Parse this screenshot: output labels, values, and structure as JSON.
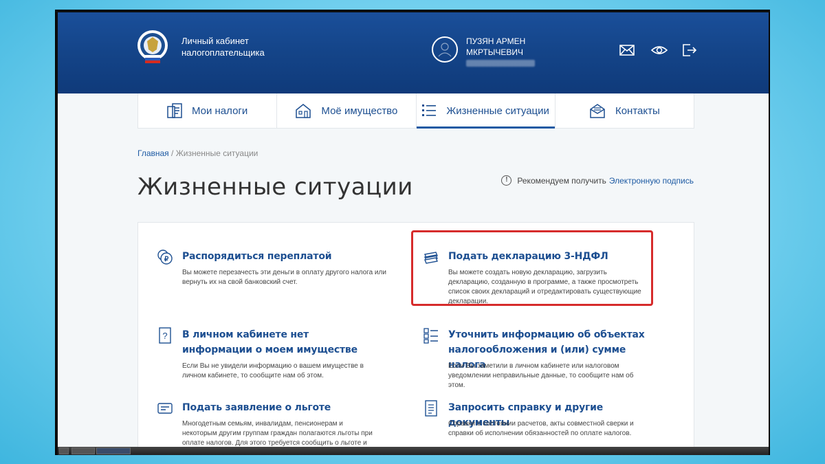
{
  "brand": {
    "line1": "Личный кабинет",
    "line2": "налогоплательщика"
  },
  "user": {
    "line1": "ПУЗЯН АРМЕН",
    "line2": "МКРТЫЧЕВИЧ"
  },
  "header_icons": [
    "mail-icon",
    "eye-icon",
    "logout-icon"
  ],
  "nav": [
    {
      "label": "Мои налоги",
      "icon": "taxes-icon"
    },
    {
      "label": "Моё имущество",
      "icon": "property-icon"
    },
    {
      "label": "Жизненные ситуации",
      "icon": "list-icon",
      "active": true
    },
    {
      "label": "Контакты",
      "icon": "contacts-icon"
    }
  ],
  "breadcrumb": {
    "home": "Главная",
    "separator": "/",
    "current": "Жизненные ситуации"
  },
  "page_title": "Жизненные ситуации",
  "recommend": {
    "text": "Рекомендуем получить",
    "link": "Электронную подпись"
  },
  "cards": [
    {
      "title": "Распорядиться переплатой",
      "text": "Вы можете перезачесть эти деньги в оплату другого налога или вернуть их на свой банковский счет."
    },
    {
      "title": "Подать декларацию 3-НДФЛ",
      "text": "Вы можете создать новую декларацию, загрузить декларацию, созданную в программе, а также просмотреть список своих деклараций и отредактировать существующие декларации."
    },
    {
      "title": "В личном кабинете нет информации о моем имуществе",
      "text": "Если Вы не увидели информацию о вашем имуществе в личном кабинете, то сообщите нам об этом."
    },
    {
      "title": "Уточнить информацию об объектах налогообложения и (или) сумме налога",
      "text": "Если Вы заметили в личном кабинете или налоговом уведомлении неправильные данные, то сообщите нам об этом."
    },
    {
      "title": "Подать заявление о льготе",
      "text": "Многодетным семьям, инвалидам, пенсионерам и некоторым другим группам граждан полагаются льготы при оплате налогов. Для этого требуется сообщить о льготе и выбрать льготный объект."
    },
    {
      "title": "Запросить справку и другие документы",
      "text": "Справки о состоянии расчетов, акты совместной сверки и справки об исполнении обязанностей по оплате налогов."
    }
  ],
  "colors": {
    "header": "#144488",
    "accent": "#1d4f91",
    "highlight": "#d62b2b"
  }
}
